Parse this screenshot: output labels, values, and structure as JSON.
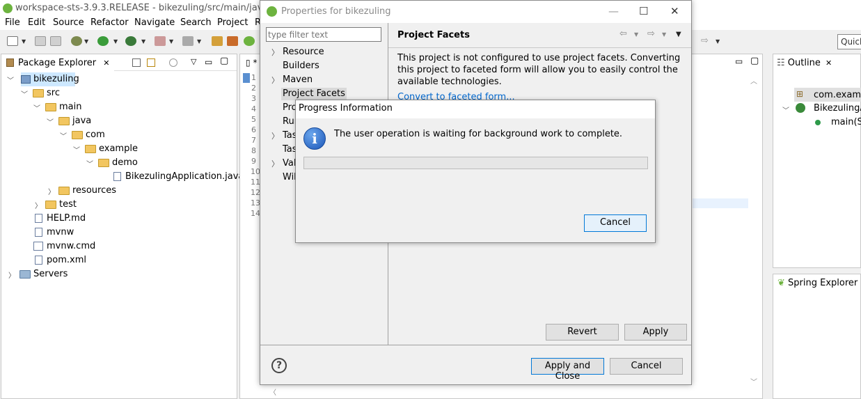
{
  "ide": {
    "window_title": "workspace-sts-3.9.3.RELEASE - bikezuling/src/main/java/com",
    "menu": [
      "File",
      "Edit",
      "Source",
      "Refactor",
      "Navigate",
      "Search",
      "Project",
      "R"
    ],
    "quick_access": "Quick"
  },
  "package_explorer": {
    "tab_label": "Package Explorer",
    "tree": [
      {
        "label": "bikezuling",
        "depth": 0,
        "expanded": true,
        "icon": "project-icon",
        "selected": true
      },
      {
        "label": "src",
        "depth": 1,
        "expanded": true,
        "icon": "folder-icon"
      },
      {
        "label": "main",
        "depth": 2,
        "expanded": true,
        "icon": "folder-icon"
      },
      {
        "label": "java",
        "depth": 3,
        "expanded": true,
        "icon": "folder-icon"
      },
      {
        "label": "com",
        "depth": 4,
        "expanded": true,
        "icon": "folder-icon"
      },
      {
        "label": "example",
        "depth": 5,
        "expanded": true,
        "icon": "folder-icon"
      },
      {
        "label": "demo",
        "depth": 6,
        "expanded": true,
        "icon": "folder-icon"
      },
      {
        "label": "BikezulingApplication.java",
        "depth": 7,
        "expanded": null,
        "icon": "java-file-icon"
      },
      {
        "label": "resources",
        "depth": 3,
        "expanded": false,
        "icon": "folder-icon"
      },
      {
        "label": "test",
        "depth": 2,
        "expanded": false,
        "icon": "folder-icon"
      },
      {
        "label": "HELP.md",
        "depth": 1,
        "expanded": null,
        "icon": "markdown-file-icon"
      },
      {
        "label": "mvnw",
        "depth": 1,
        "expanded": null,
        "icon": "file-icon"
      },
      {
        "label": "mvnw.cmd",
        "depth": 1,
        "expanded": null,
        "icon": "cmd-file-icon"
      },
      {
        "label": "pom.xml",
        "depth": 1,
        "expanded": null,
        "icon": "maven-file-icon"
      },
      {
        "label": "Servers",
        "depth": 0,
        "expanded": false,
        "icon": "folder-icon"
      }
    ]
  },
  "editor": {
    "tab_label": "*",
    "line_numbers": [
      "1",
      "2",
      "3",
      "4",
      "5",
      "6",
      "7",
      "8",
      "9",
      "10",
      "11",
      "12",
      "13",
      "14"
    ]
  },
  "outline": {
    "tab_label": "Outline",
    "items": [
      "com.examp",
      "BikezulingA",
      "main(St"
    ]
  },
  "spring_explorer": {
    "tab_label": "Spring Explorer"
  },
  "properties_dialog": {
    "title": "Properties for bikezuling",
    "filter_placeholder": "type filter text",
    "nav": [
      {
        "label": "Resource",
        "has_children": true
      },
      {
        "label": "Builders",
        "has_children": false
      },
      {
        "label": "Maven",
        "has_children": true
      },
      {
        "label": "Project Facets",
        "has_children": false,
        "selected": true
      },
      {
        "label": "Pro",
        "has_children": false
      },
      {
        "label": "Run",
        "has_children": false
      },
      {
        "label": "Tas",
        "has_children": true
      },
      {
        "label": "Tas",
        "has_children": false
      },
      {
        "label": "Vali",
        "has_children": true
      },
      {
        "label": "Wik",
        "has_children": false
      }
    ],
    "page_title": "Project Facets",
    "description": "This project is not configured to use project facets. Converting this project to faceted form will allow you to easily control the available technologies.",
    "convert_link": "Convert to faceted form...",
    "revert_label": "Revert",
    "apply_label": "Apply",
    "apply_close_label": "Apply and Close",
    "cancel_label": "Cancel",
    "help_symbol": "?"
  },
  "progress_dialog": {
    "title": "Progress Information",
    "message": "The user operation is waiting for background work to complete.",
    "progress_fraction": 0,
    "cancel_label": "Cancel",
    "info_symbol": "i"
  },
  "colors": {
    "selection": "#cde8ff",
    "dialog_bg": "#f0f0f0",
    "link": "#0066cc",
    "default_button_border": "#0078d7",
    "spring_green": "#6db33f"
  }
}
